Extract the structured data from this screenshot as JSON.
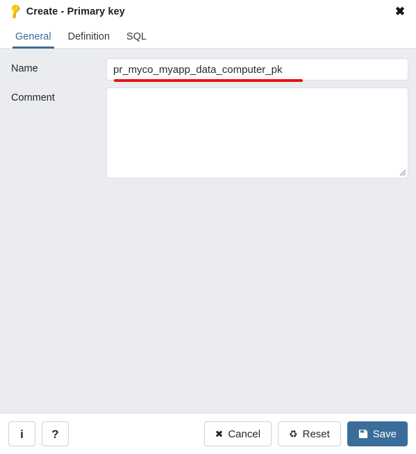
{
  "window": {
    "icon": "key-icon",
    "title": "Create - Primary key",
    "close_label": "✖"
  },
  "tabs": [
    {
      "label": "General",
      "active": true
    },
    {
      "label": "Definition",
      "active": false
    },
    {
      "label": "SQL",
      "active": false
    }
  ],
  "form": {
    "name": {
      "label": "Name",
      "value": "pr_myco_myapp_data_computer_pk",
      "placeholder": ""
    },
    "comment": {
      "label": "Comment",
      "value": "",
      "placeholder": ""
    }
  },
  "annotation": {
    "color": "#ee1111",
    "target": "name-input"
  },
  "footer": {
    "info_label": "i",
    "help_label": "?",
    "cancel_label": "Cancel",
    "cancel_icon": "✖",
    "reset_label": "Reset",
    "reset_icon": "♻",
    "save_label": "Save",
    "save_icon": "floppy-disk-icon"
  },
  "colors": {
    "accent": "#3a6d99",
    "body_background": "#eaecf0",
    "panel_background": "#ffffff",
    "annotation_red": "#ee1111",
    "key_icon": "#d6b600"
  }
}
